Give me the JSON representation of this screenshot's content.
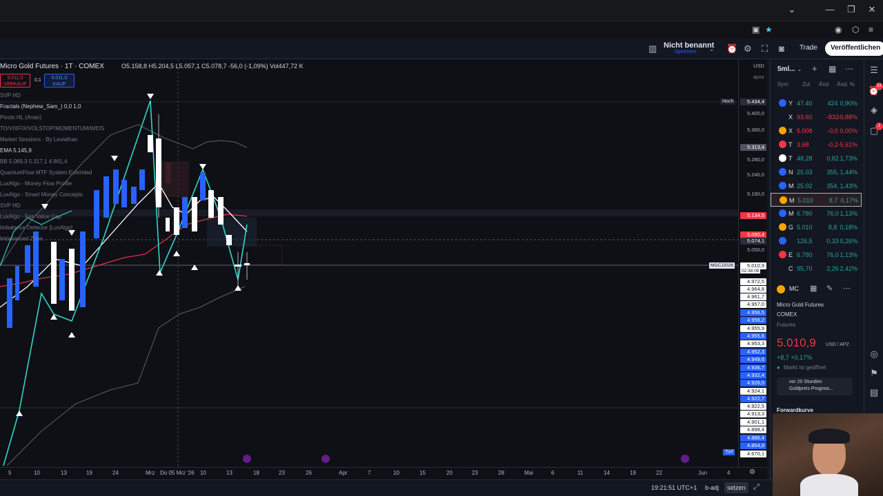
{
  "os": {
    "minimize": "—",
    "restore": "❐",
    "close": "✕",
    "chevron": "⌄"
  },
  "toolbar": {
    "layout_name": "Nicht benannt",
    "layout_sub": "Speichern",
    "trade_label": "Trade",
    "publish_label": "Veröffentlichen"
  },
  "legend": {
    "symbol": "Micro Gold Futures · 1T · COMEX",
    "ohlc": "O5.158,8  H5.204,5  L5.057,1  C5.078,7  -56,0 (-1,09%)  Vol447,72 K",
    "sell_price": "5.011,0",
    "sell_label": "VERKAUF",
    "qty": "0,1",
    "buy_price": "5.011,0",
    "buy_label": "KAUF",
    "indicators": [
      {
        "name": "SVP HD"
      },
      {
        "name": "Fractals (Nephew_Sam_)  0,0  1,0",
        "bright": true
      },
      {
        "name": "Pivots HL (Anan)"
      },
      {
        "name": "TD/VIXFIX/VOLSTOP/MOMENTUM/WEIS"
      },
      {
        "name": "Market Sessions - By Leviathan"
      },
      {
        "name": "EMA  5.145,9",
        "bright": true
      },
      {
        "name": "BB  5.089,3  5.317,1  4.861,4"
      },
      {
        "name": "QuantumFlow MTF System Extended"
      },
      {
        "name": "LuxAlgo - Money Flow Profile"
      },
      {
        "name": "LuxAlgo - Smart Money Concepts"
      },
      {
        "name": "SVP HD"
      },
      {
        "name": "LuxAlgo - Fair Value Gap"
      },
      {
        "name": "Imbalance Detector [LuxAlgo]"
      },
      {
        "name": "Imbalanced Zone"
      }
    ]
  },
  "price_scale": {
    "currency": "USD",
    "unit": "apoz",
    "hoch_label": "Hoch",
    "tief_label": "Tief",
    "contract_label": "MGCJ2026",
    "countdown": "02:38:08",
    "labels": [
      {
        "v": "5.434,4",
        "c": "#2a2e39"
      },
      {
        "v": "5.400,0"
      },
      {
        "v": "5.360,0"
      },
      {
        "v": "5.313,4",
        "c": "#50535e"
      },
      {
        "v": "5.280,0"
      },
      {
        "v": "5.240,0"
      },
      {
        "v": "5.190,0"
      },
      {
        "v": "5.134,5",
        "c": "#f23645"
      },
      {
        "v": "5.090,4",
        "c": "#f23645"
      },
      {
        "v": "5.074,1",
        "c": "#2a2e39"
      },
      {
        "v": "5.050,0"
      },
      {
        "v": "5.010,9",
        "c": "#ffffff"
      },
      {
        "v": "4.972,5",
        "c": "#ffffff"
      },
      {
        "v": "4.964,8",
        "c": "#ffffff"
      },
      {
        "v": "4.961,7",
        "c": "#ffffff"
      },
      {
        "v": "4.957,0",
        "c": "#ffffff"
      },
      {
        "v": "4.956,5",
        "c": "#2962ff"
      },
      {
        "v": "4.956,2",
        "c": "#2962ff"
      },
      {
        "v": "4.955,9",
        "c": "#ffffff"
      },
      {
        "v": "4.955,6",
        "c": "#2962ff"
      },
      {
        "v": "4.953,3",
        "c": "#ffffff"
      },
      {
        "v": "4.952,3",
        "c": "#2962ff"
      },
      {
        "v": "4.949,6",
        "c": "#2962ff"
      },
      {
        "v": "4.936,7",
        "c": "#2962ff"
      },
      {
        "v": "4.932,4",
        "c": "#2962ff"
      },
      {
        "v": "4.926,5",
        "c": "#2962ff"
      },
      {
        "v": "4.924,1",
        "c": "#ffffff"
      },
      {
        "v": "4.922,7",
        "c": "#2962ff"
      },
      {
        "v": "4.922,5",
        "c": "#ffffff"
      },
      {
        "v": "4.913,3",
        "c": "#ffffff"
      },
      {
        "v": "4.901,1",
        "c": "#ffffff"
      },
      {
        "v": "4.898,4",
        "c": "#ffffff"
      },
      {
        "v": "4.886,4",
        "c": "#2962ff"
      },
      {
        "v": "4.854,8",
        "c": "#2962ff"
      },
      {
        "v": "4.670,1",
        "c": "#ffffff"
      }
    ]
  },
  "time_axis": {
    "labels": [
      "5",
      "10",
      "13",
      "19",
      "24",
      "Mrz",
      "Do 05 Mrz '26",
      "10",
      "13",
      "18",
      "23",
      "26",
      "Apr",
      "7",
      "10",
      "15",
      "20",
      "23",
      "28",
      "Mai",
      "6",
      "11",
      "14",
      "19",
      "22",
      "Jun",
      "4"
    ]
  },
  "status": {
    "clock": "19:21:51 UTC+1",
    "badj": "b-adj",
    "settings": "setzen"
  },
  "watchlist": {
    "title": "5ml...",
    "cols": [
      "Sym",
      "Zul",
      "Änd",
      "Änd. %"
    ],
    "rows": [
      {
        "icon_color": "#2962ff",
        "sym": "Y",
        "last": "47.40",
        "chg": "424",
        "pct": "0,90%",
        "dir": "up"
      },
      {
        "icon_color": "#131722",
        "sym": "X",
        "last": "93.60",
        "chg": "-832",
        "pct": "-0,88%",
        "dir": "dn"
      },
      {
        "icon_color": "#f7a600",
        "sym": "X",
        "last": "5.008",
        "chg": "-0,0",
        "pct": "0,00%",
        "dir": "dn"
      },
      {
        "icon_color": "#f23645",
        "sym": "T",
        "last": "3,68",
        "chg": "-0,2",
        "pct": "-5,61%",
        "dir": "dn"
      },
      {
        "icon_color": "#ffffff",
        "sym": "T",
        "last": "48,28",
        "chg": "0,82",
        "pct": "1,73%",
        "dir": "up"
      },
      {
        "icon_color": "#2962ff",
        "sym": "N",
        "last": "25.03",
        "chg": "355,",
        "pct": "1,44%",
        "dir": "up"
      },
      {
        "icon_color": "#2962ff",
        "sym": "M",
        "last": "25.02",
        "chg": "354,",
        "pct": "1,43%",
        "dir": "up"
      },
      {
        "icon_color": "#f7a600",
        "sym": "M",
        "last": "5.010",
        "chg": "8,7",
        "pct": "0,17%",
        "dir": "up",
        "selected": true
      },
      {
        "icon_color": "#2962ff",
        "sym": "M",
        "last": "6.780",
        "chg": "76,0",
        "pct": "1,13%",
        "dir": "up"
      },
      {
        "icon_color": "#f7a600",
        "sym": "G",
        "last": "5.010",
        "chg": "8,8",
        "pct": "0,18%",
        "dir": "up"
      },
      {
        "icon_color": "#2962ff",
        "sym": "",
        "last": "126,5",
        "chg": "0,33",
        "pct": "0,26%",
        "dir": "up"
      },
      {
        "icon_color": "#f23645",
        "sym": "E",
        "last": "6.780",
        "chg": "76,0",
        "pct": "1,13%",
        "dir": "up"
      },
      {
        "icon_color": "#131722",
        "sym": "C",
        "last": "95,70",
        "chg": "2,26",
        "pct": "2,42%",
        "dir": "up"
      }
    ]
  },
  "detail": {
    "symbol_short": "MC",
    "name": "Micro Gold Futures",
    "exchange": "COMEX",
    "type": "Futures",
    "price": "5.010,9",
    "price_unit": "USD / APZ",
    "change": "+8,7  +0,17%",
    "market_status": "Markt ist geöffnet",
    "news_time": "vor 20 Stunden",
    "news_title": "Goldpreis Prognos...",
    "forward_label": "Forwardkurve"
  }
}
